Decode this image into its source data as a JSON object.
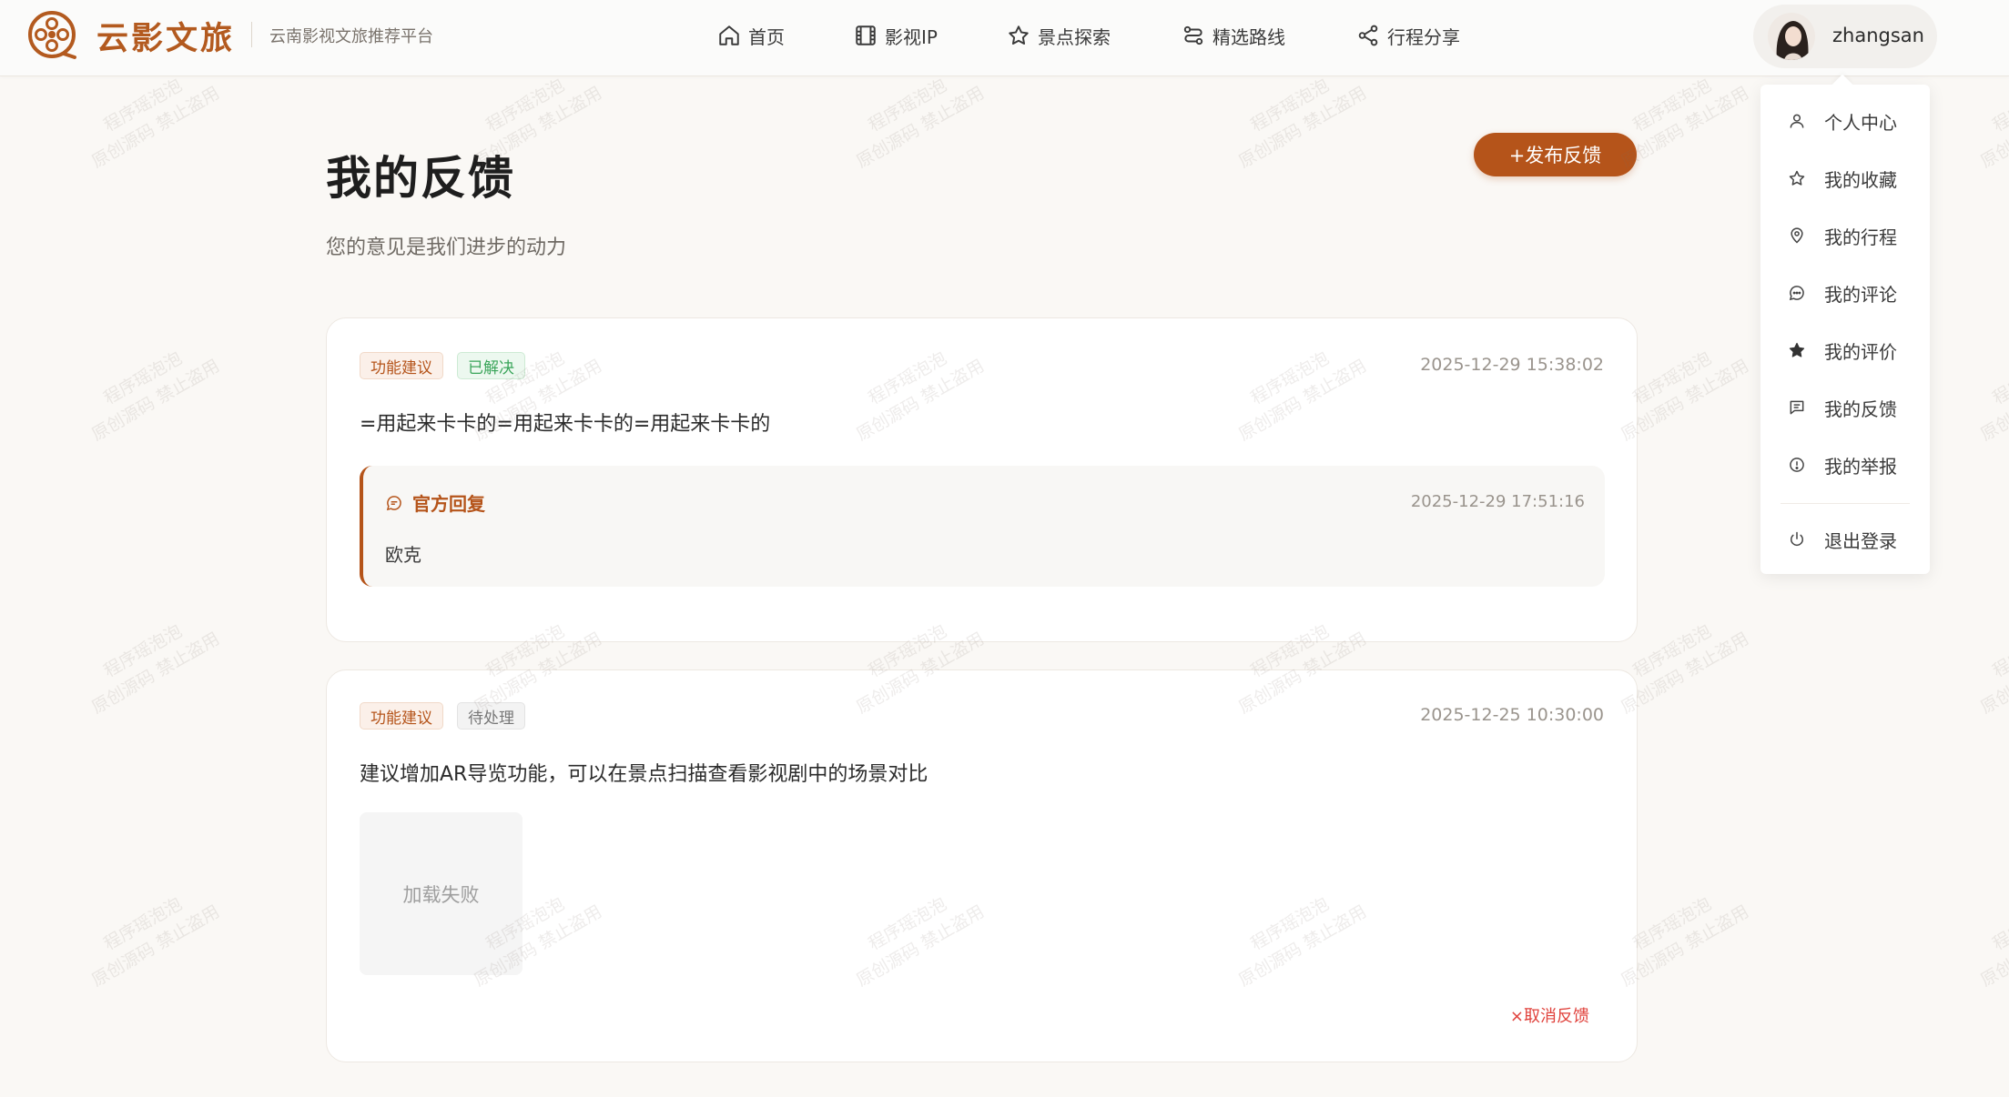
{
  "header": {
    "brand_name": "云影文旅",
    "brand_subtitle": "云南影视文旅推荐平台",
    "nav": [
      {
        "label": "首页",
        "icon": "home-icon"
      },
      {
        "label": "影视IP",
        "icon": "film-icon"
      },
      {
        "label": "景点探索",
        "icon": "star-icon"
      },
      {
        "label": "精选路线",
        "icon": "route-icon"
      },
      {
        "label": "行程分享",
        "icon": "share-icon"
      }
    ],
    "user": {
      "name": "zhangsan"
    }
  },
  "user_menu": {
    "items": [
      {
        "label": "个人中心",
        "icon": "user-icon"
      },
      {
        "label": "我的收藏",
        "icon": "star-outline-icon"
      },
      {
        "label": "我的行程",
        "icon": "location-pin-icon"
      },
      {
        "label": "我的评论",
        "icon": "chat-bubble-icon"
      },
      {
        "label": "我的评价",
        "icon": "star-filled-icon"
      },
      {
        "label": "我的反馈",
        "icon": "message-square-icon"
      },
      {
        "label": "我的举报",
        "icon": "alert-circle-icon"
      },
      {
        "label": "退出登录",
        "icon": "power-icon"
      }
    ]
  },
  "page": {
    "title": "我的反馈",
    "subtitle": "您的意见是我们进步的动力",
    "publish_button": "+发布反馈"
  },
  "feedbacks": [
    {
      "type_tag": "功能建议",
      "status_tag": "已解决",
      "time": "2025-12-29 15:38:02",
      "content": "=用起来卡卡的=用起来卡卡的=用起来卡卡的",
      "reply": {
        "title": "官方回复",
        "time": "2025-12-29 17:51:16",
        "content": "欧克"
      }
    },
    {
      "type_tag": "功能建议",
      "status_tag": "待处理",
      "time": "2025-12-25 10:30:00",
      "content": "建议增加AR导览功能，可以在景点扫描查看影视剧中的场景对比",
      "image_status": "加载失败",
      "cancel_label": "×取消反馈"
    }
  ],
  "watermark": {
    "line1": "程序瑶泡泡",
    "line2": "原创源码 禁止盗用"
  },
  "colors": {
    "accent": "#b5541a",
    "resolved": "#3aa55a",
    "cancel": "#e0413b"
  }
}
